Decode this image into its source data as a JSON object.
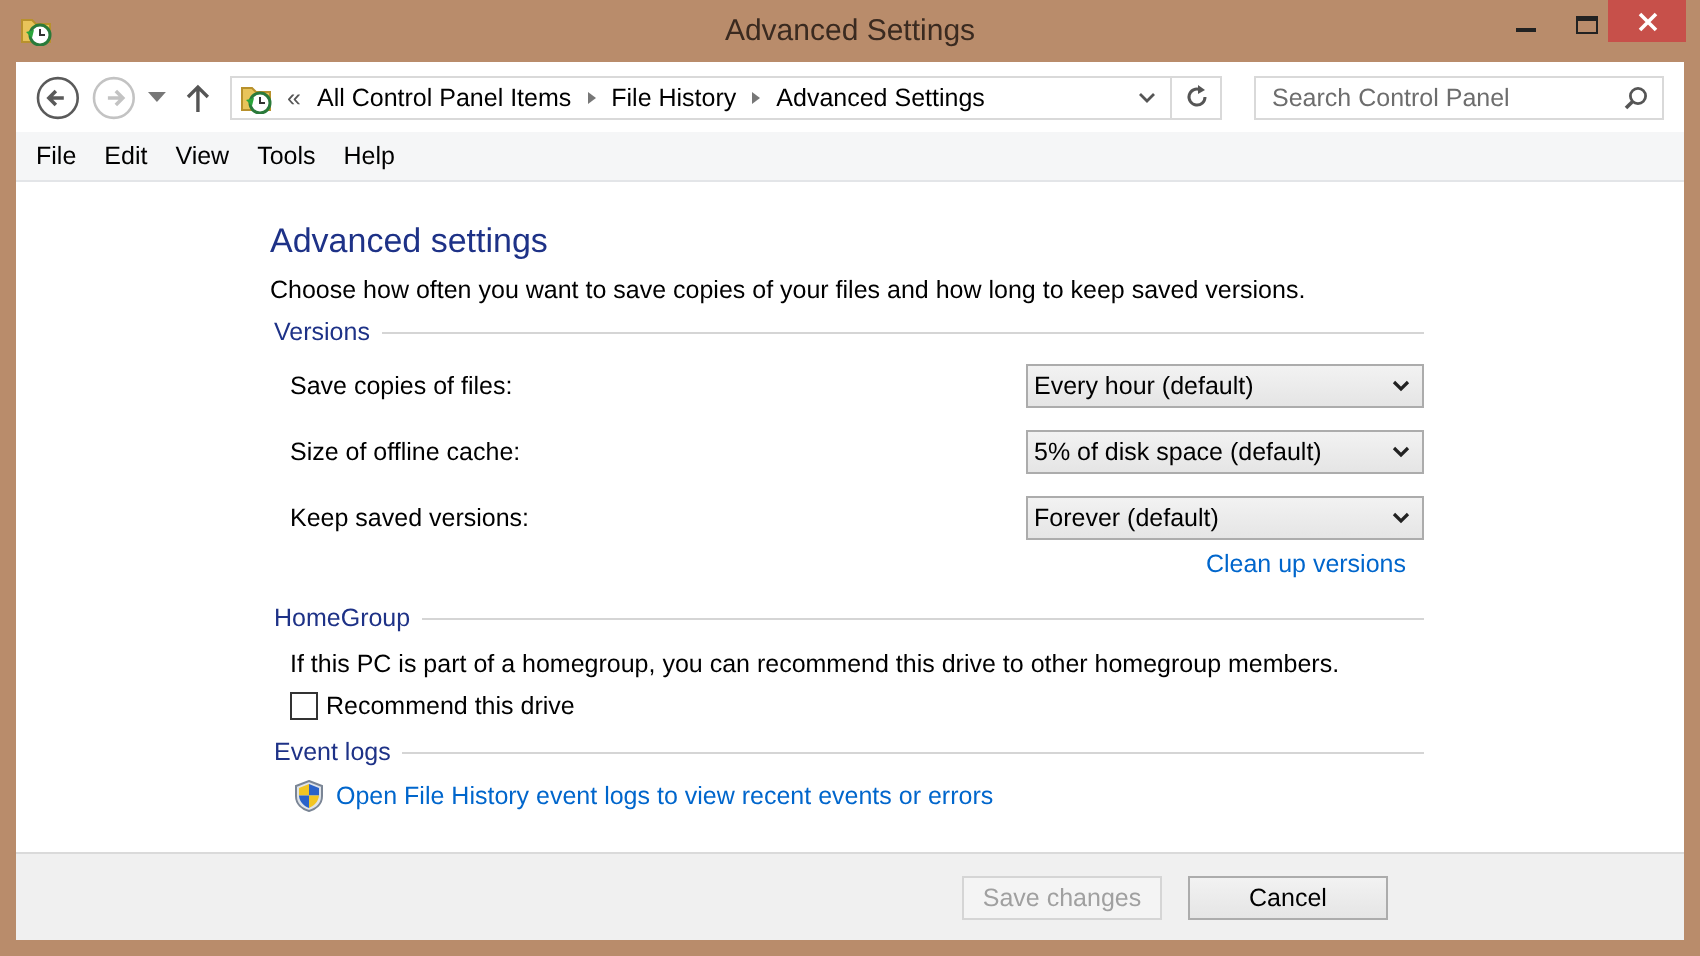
{
  "window": {
    "title": "Advanced Settings"
  },
  "navigation": {
    "back_disabled": false,
    "forward_disabled": true,
    "overflow": "«",
    "breadcrumb": [
      "All Control Panel Items",
      "File History",
      "Advanced Settings"
    ]
  },
  "search": {
    "placeholder": "Search Control Panel"
  },
  "menu": [
    "File",
    "Edit",
    "View",
    "Tools",
    "Help"
  ],
  "heading": "Advanced settings",
  "intro": "Choose how often you want to save copies of your files and how long to keep saved versions.",
  "sections": [
    {
      "title": "Versions",
      "items": [
        {
          "kind": "dropdown",
          "label": "Save copies of files:",
          "value": "Every hour (default)"
        },
        {
          "kind": "dropdown",
          "label": "Size of offline cache:",
          "value": "5% of disk space (default)"
        },
        {
          "kind": "dropdown",
          "label": "Keep saved versions:",
          "value": "Forever (default)"
        },
        {
          "kind": "link",
          "text": "Clean up versions"
        }
      ]
    },
    {
      "title": "HomeGroup",
      "items": [
        {
          "kind": "text",
          "text": "If this PC is part of a homegroup, you can recommend this drive to other homegroup members."
        },
        {
          "kind": "checkbox",
          "label": "Recommend this drive",
          "checked": false
        }
      ]
    },
    {
      "title": "Event logs",
      "items": [
        {
          "kind": "shield-link",
          "text": "Open File History event logs to view recent events or errors"
        }
      ]
    }
  ],
  "buttons": [
    {
      "label": "Save changes",
      "disabled": true
    },
    {
      "label": "Cancel",
      "disabled": false
    }
  ]
}
